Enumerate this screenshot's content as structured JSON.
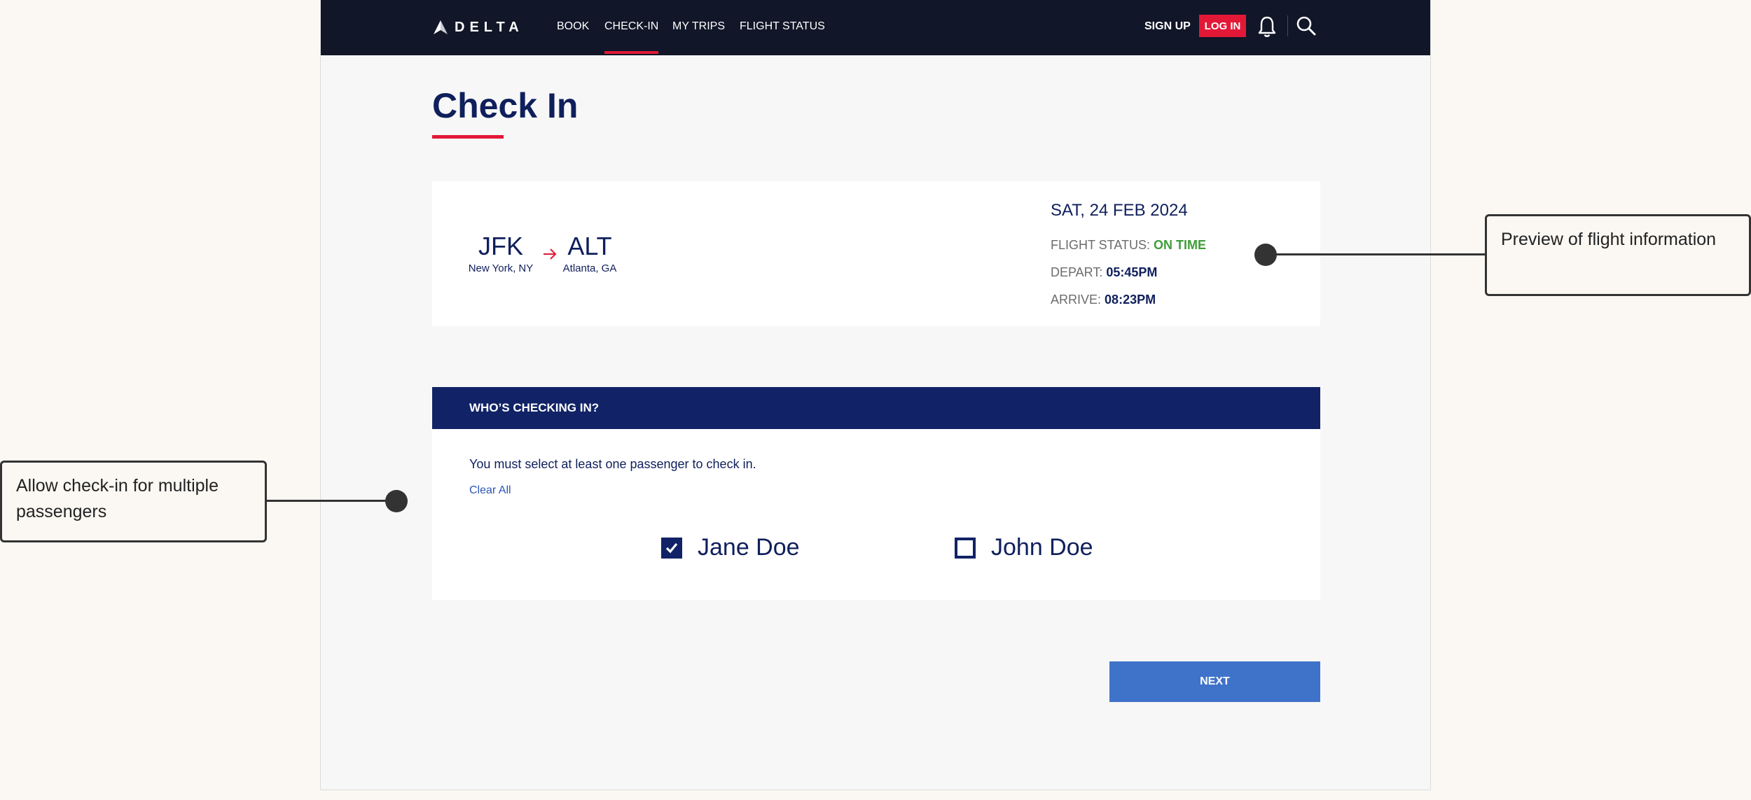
{
  "nav": {
    "logo_text": "DELTA",
    "links": [
      "BOOK",
      "CHECK-IN",
      "MY TRIPS",
      "FLIGHT STATUS"
    ],
    "active_link": "CHECK-IN",
    "sign_up": "SIGN UP",
    "log_in": "LOG IN"
  },
  "page": {
    "title": "Check In"
  },
  "flight": {
    "origin_code": "JFK",
    "origin_city": "New York, NY",
    "dest_code": "ALT",
    "dest_city": "Atlanta, GA",
    "date": "SAT, 24 FEB 2024",
    "status_label": "FLIGHT STATUS:",
    "status_value": "ON TIME",
    "depart_label": "DEPART:",
    "depart_time": "05:45PM",
    "arrive_label": "ARRIVE:",
    "arrive_time": "08:23PM"
  },
  "passengers": {
    "header": "WHO’S CHECKING IN?",
    "instruction": "You must select at least one passenger to check in.",
    "clear_all": "Clear All",
    "list": [
      {
        "name": "Jane Doe",
        "checked": true
      },
      {
        "name": "John Doe",
        "checked": false
      }
    ]
  },
  "actions": {
    "next": "NEXT"
  },
  "annotations": {
    "flight_preview": "Preview of flight information",
    "multi_passenger": "Allow check-in for multiple passengers"
  },
  "colors": {
    "nav_bg": "#111628",
    "brand_red": "#e31837",
    "navy": "#0f1f5c",
    "header_navy": "#112366",
    "on_time_green": "#3e9e3a",
    "next_blue": "#3f72c9"
  }
}
